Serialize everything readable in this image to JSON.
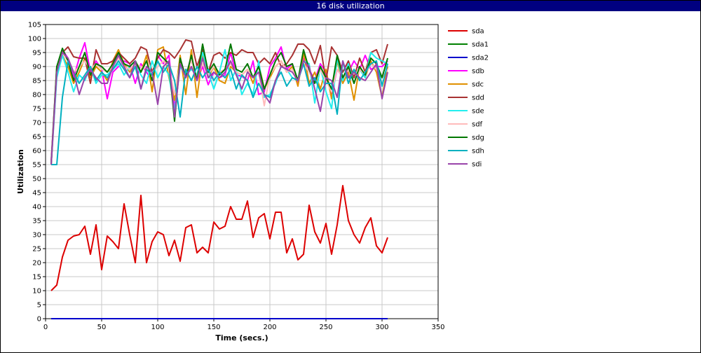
{
  "window": {
    "title": "16 disk utilization"
  },
  "chart_data": {
    "type": "line",
    "xlabel": "Time (secs.)",
    "ylabel": "Utilization",
    "xlim": [
      0,
      350
    ],
    "ylim": [
      0,
      105
    ],
    "xticks": [
      0,
      50,
      100,
      150,
      200,
      250,
      300,
      350
    ],
    "yticks": [
      0,
      5,
      10,
      15,
      20,
      25,
      30,
      35,
      40,
      45,
      50,
      55,
      60,
      65,
      70,
      75,
      80,
      85,
      90,
      95,
      100,
      105
    ],
    "grid": true,
    "legend_position": "right",
    "x": [
      5,
      10,
      15,
      20,
      25,
      30,
      35,
      40,
      45,
      50,
      55,
      60,
      65,
      70,
      75,
      80,
      85,
      90,
      95,
      100,
      105,
      110,
      115,
      120,
      125,
      130,
      135,
      140,
      145,
      150,
      155,
      160,
      165,
      170,
      175,
      180,
      185,
      190,
      195,
      200,
      205,
      210,
      215,
      220,
      225,
      230,
      235,
      240,
      245,
      250,
      255,
      260,
      265,
      270,
      275,
      280,
      285,
      290,
      295,
      300,
      305
    ],
    "series": [
      {
        "name": "sda",
        "color": "#dd0000",
        "values": [
          10,
          12,
          22,
          28,
          29.5,
          30,
          33,
          23,
          33.5,
          17.5,
          29.5,
          27.5,
          25,
          41,
          30,
          20,
          44,
          20,
          27.5,
          31,
          30,
          22.5,
          28,
          20.5,
          32.5,
          33.5,
          23.5,
          25.5,
          23.5,
          34.5,
          32,
          33,
          40,
          35.5,
          35.5,
          42,
          29,
          36,
          37.5,
          28.5,
          38,
          38,
          23.5,
          28.5,
          21,
          23,
          40.5,
          31,
          27,
          34,
          23,
          33.5,
          47.5,
          35,
          30,
          27,
          32.5,
          36,
          26,
          23.5,
          29
        ]
      },
      {
        "name": "sda1",
        "color": "#008000",
        "values": [
          0,
          0,
          0,
          0,
          0,
          0,
          0,
          0,
          0,
          0,
          0,
          0,
          0,
          0,
          0,
          0,
          0,
          0,
          0,
          0,
          0,
          0,
          0,
          0,
          0,
          0,
          0,
          0,
          0,
          0,
          0,
          0,
          0,
          0,
          0,
          0,
          0,
          0,
          0,
          0,
          0,
          0,
          0,
          0,
          0,
          0,
          0,
          0,
          0,
          0,
          0,
          0,
          0,
          0,
          0,
          0,
          0,
          0,
          0,
          0,
          0
        ]
      },
      {
        "name": "sda2",
        "color": "#0000cc",
        "values": [
          0,
          0,
          0,
          0,
          0,
          0,
          0,
          0,
          0,
          0,
          0,
          0,
          0,
          0,
          0,
          0,
          0,
          0,
          0,
          0,
          0,
          0,
          0,
          0,
          0,
          0,
          0,
          0,
          0,
          0,
          0,
          0,
          0,
          0,
          0,
          0,
          0,
          0,
          0,
          0,
          0,
          0,
          0,
          0,
          0,
          0,
          0,
          0,
          0,
          0,
          0,
          0,
          0,
          0,
          0,
          0,
          0,
          0,
          0,
          0,
          0
        ]
      },
      {
        "name": "sdb",
        "color": "#ff00ff",
        "values": [
          56,
          88,
          96,
          93,
          86,
          93,
          98.5,
          88,
          92,
          89,
          78.5,
          88,
          90,
          92,
          91,
          84,
          91,
          88,
          85,
          94,
          91,
          94,
          75,
          93,
          86,
          94,
          85,
          90,
          83.5,
          88,
          86,
          87,
          95,
          87,
          86.5,
          85,
          92,
          80,
          81,
          90,
          93,
          97,
          89,
          91,
          84,
          93,
          89,
          85,
          91,
          88,
          80,
          89,
          86,
          88,
          92,
          89,
          94,
          89,
          90,
          90,
          92
        ]
      },
      {
        "name": "sdc",
        "color": "#e09000",
        "values": [
          55,
          87,
          94,
          90,
          84,
          88,
          93,
          86,
          90,
          88,
          85,
          92,
          96,
          91,
          88,
          91,
          88,
          94,
          81,
          96,
          97,
          86,
          78,
          94,
          80,
          96,
          79,
          94,
          86,
          90,
          85,
          84,
          90,
          88,
          87,
          89,
          84,
          91,
          82,
          86,
          90,
          92,
          88,
          90,
          83,
          95,
          84,
          88,
          82,
          89,
          78.5,
          92,
          84,
          88,
          78,
          90,
          86,
          92,
          88,
          79,
          90
        ]
      },
      {
        "name": "sdd",
        "color": "#a83232",
        "values": [
          56,
          90,
          95,
          97,
          93.5,
          93,
          93,
          84,
          96,
          91,
          91,
          92,
          95,
          93,
          91,
          93,
          97,
          96,
          88,
          93,
          96,
          95,
          93,
          96,
          99.5,
          99,
          90,
          96,
          88,
          94,
          95,
          93,
          95,
          94,
          96,
          95,
          95,
          91,
          93,
          91,
          95,
          90,
          91,
          94,
          98,
          98,
          96,
          91,
          97.5,
          85,
          97,
          94,
          88,
          92,
          86,
          93,
          88,
          95,
          96,
          91,
          98
        ]
      },
      {
        "name": "sde",
        "color": "#22eeee",
        "values": [
          55,
          86,
          94,
          88,
          81,
          87,
          85,
          90,
          84,
          87,
          87,
          89,
          91,
          87,
          90,
          92,
          87,
          84,
          92,
          86,
          90,
          87,
          74,
          90,
          87,
          89,
          87,
          95,
          88,
          82,
          88,
          96,
          85,
          89,
          80,
          84,
          80,
          92,
          79,
          80,
          84,
          90,
          89,
          86,
          85,
          92,
          91,
          77,
          90,
          81,
          75,
          93,
          85,
          91,
          84,
          89,
          86,
          95,
          93,
          92,
          91
        ]
      },
      {
        "name": "sdf",
        "color": "#ffbbbb",
        "values": [
          55,
          89,
          95,
          92,
          88,
          90,
          92,
          89,
          91,
          89,
          88,
          90,
          93,
          90,
          89,
          91,
          90,
          89,
          88,
          90,
          92,
          90,
          80,
          91,
          88,
          92,
          86,
          91,
          87,
          90,
          88,
          89,
          91,
          88,
          87,
          89,
          86,
          88,
          76,
          87,
          90,
          92,
          88,
          89,
          85,
          91,
          88,
          84,
          89,
          85,
          81,
          89,
          86,
          89,
          84,
          89,
          87,
          91,
          89,
          86,
          89
        ]
      },
      {
        "name": "sdg",
        "color": "#007700",
        "values": [
          55,
          90,
          96.5,
          92,
          85,
          90,
          95,
          87,
          91,
          90,
          88,
          91,
          95,
          91,
          90,
          92,
          88,
          92,
          85,
          95,
          93,
          91,
          70.5,
          93,
          86,
          94,
          85,
          98,
          88,
          91,
          87,
          89,
          98,
          89,
          88,
          91,
          86,
          90,
          82,
          87,
          92,
          95,
          90,
          91,
          85,
          96,
          89,
          84,
          90,
          86,
          82,
          94,
          86,
          90,
          84,
          90,
          87,
          93,
          91,
          86,
          93
        ]
      },
      {
        "name": "sdh",
        "color": "#00b0c0",
        "values": [
          55,
          55,
          79,
          92,
          88,
          84,
          87,
          90,
          85,
          88,
          86,
          89,
          92,
          89,
          86,
          90,
          82,
          89,
          87,
          92,
          88,
          91,
          85,
          72,
          89,
          85,
          90,
          86,
          89,
          85,
          88,
          86,
          89,
          82,
          87,
          85,
          79,
          84,
          80,
          79,
          85,
          88,
          83,
          86,
          85,
          91,
          83,
          86,
          81,
          84,
          84,
          73,
          92,
          84,
          89,
          85,
          88,
          91,
          92,
          83,
          91
        ]
      },
      {
        "name": "sdi",
        "color": "#9944aa",
        "values": [
          55,
          88,
          95,
          93,
          88,
          80,
          86,
          89,
          86,
          84,
          84,
          90,
          94,
          90,
          86,
          92,
          82,
          90,
          88,
          76.5,
          90,
          92,
          72,
          91,
          86,
          90,
          85,
          93,
          86,
          88,
          86,
          88,
          92,
          87,
          82,
          88,
          86,
          88,
          80,
          77,
          85,
          90,
          89,
          88,
          85,
          92,
          90,
          82,
          74,
          86,
          85,
          79,
          92,
          86,
          88,
          86,
          85,
          88,
          91,
          78.5,
          88
        ]
      }
    ]
  }
}
